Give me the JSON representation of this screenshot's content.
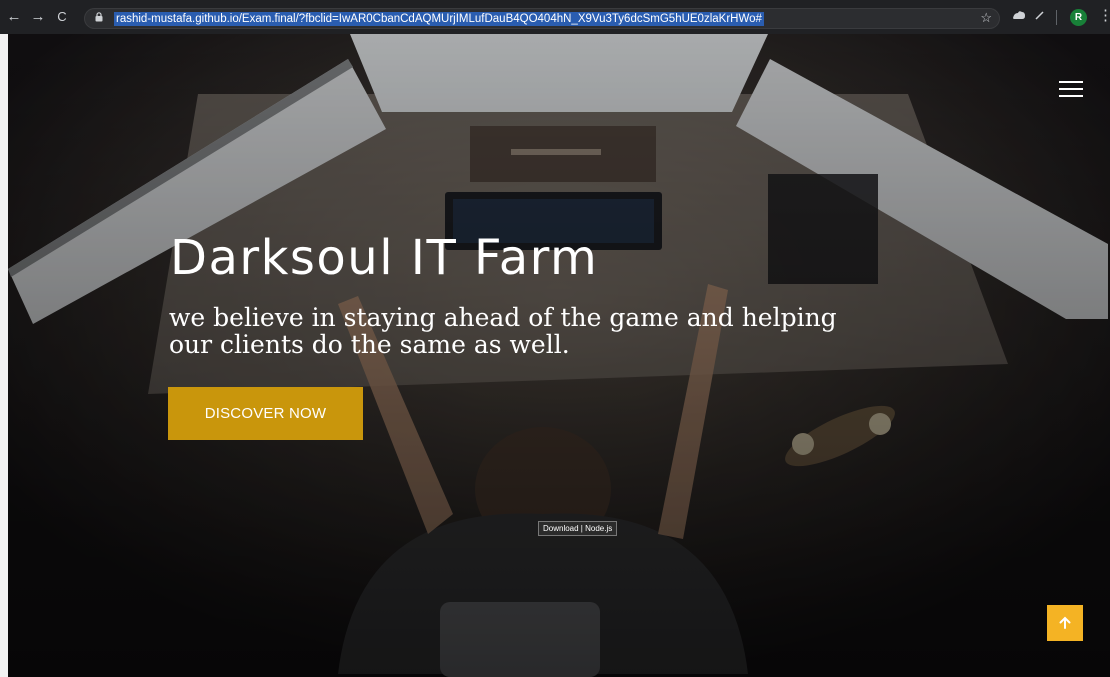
{
  "browser": {
    "url": "rashid-mustafa.github.io/Exam.final/?fbclid=IwAR0CbanCdAQMUrjIMLufDauB4QO404hN_X9Vu3Ty6dcSmG5hUE0zlaKrHWo#",
    "profile_initial": "R",
    "icons": [
      "back-arrow-icon",
      "forward-arrow-icon",
      "reload-icon",
      "lock-icon",
      "star-icon",
      "extension-icon",
      "pen-icon",
      "menu-dots-icon"
    ]
  },
  "hero": {
    "title": "Darksoul IT Farm",
    "subtitle": "we believe in staying ahead of the game and helping our clients do the same as well.",
    "cta_label": "DISCOVER NOW"
  },
  "tooltip": "Download | Node.js",
  "icons": {
    "menu": "hamburger-menu-icon",
    "scroll_top": "arrow-up-icon"
  },
  "colors": {
    "cta": "#c9960c",
    "scroll_top": "#f4b324",
    "chrome": "#202124",
    "url_highlight": "#2a5db0"
  }
}
